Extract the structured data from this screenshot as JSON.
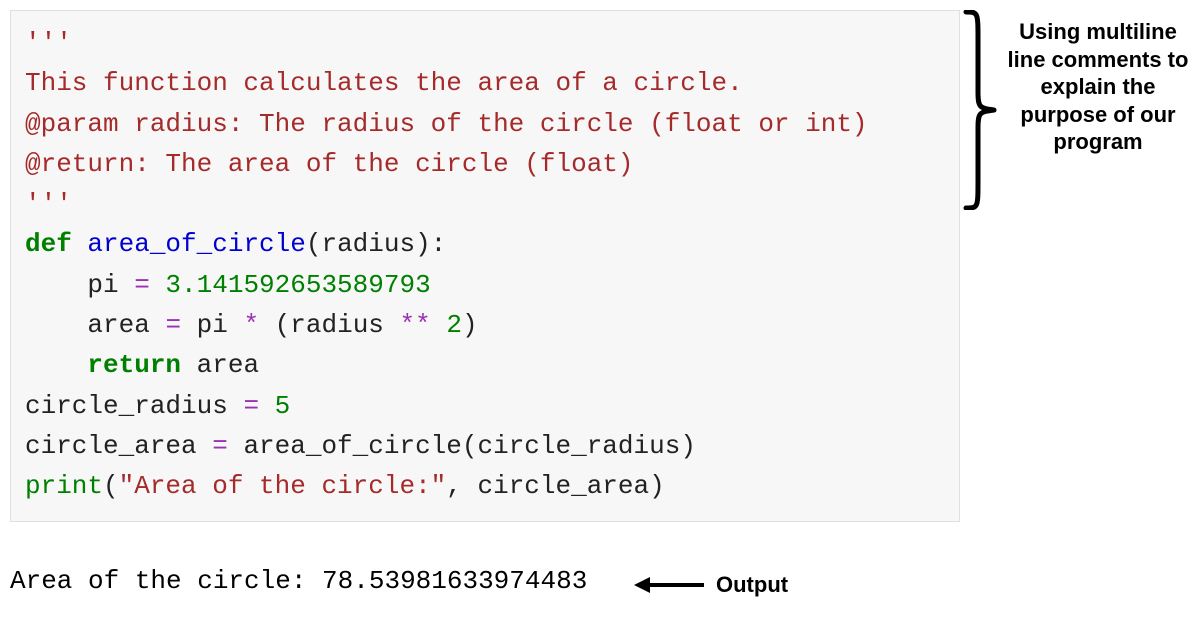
{
  "code": {
    "doc_open": "'''",
    "doc_line1": "This function calculates the area of a circle.",
    "doc_line2": "@param radius: The radius of the circle (float or int)",
    "doc_line3": "@return: The area of the circle (float)",
    "doc_close": "'''",
    "def_kw": "def",
    "def_name": "area_of_circle",
    "def_params": "(radius):",
    "pi_lhs": "    pi ",
    "pi_eq": "=",
    "pi_val": " 3.141592653589793",
    "area_lhs": "    area ",
    "area_eq": "=",
    "area_pi": " pi ",
    "area_star": "*",
    "area_par_open": " (radius ",
    "area_pow": "**",
    "area_two": " 2",
    "area_par_close": ")",
    "ret_indent": "    ",
    "ret_kw": "return",
    "ret_val": " area",
    "blank": "",
    "cr_line": "circle_radius ",
    "cr_eq": "=",
    "cr_val": " 5",
    "ca_line": "circle_area ",
    "ca_eq": "=",
    "ca_call": " area_of_circle(circle_radius)",
    "print_kw": "print",
    "print_open": "(",
    "print_str": "\"Area of the circle:\"",
    "print_rest": ", circle_area)"
  },
  "output": "Area of the circle: 78.53981633974483",
  "annotation_top": "Using multiline line comments to explain the purpose of our program",
  "output_label": "Output"
}
